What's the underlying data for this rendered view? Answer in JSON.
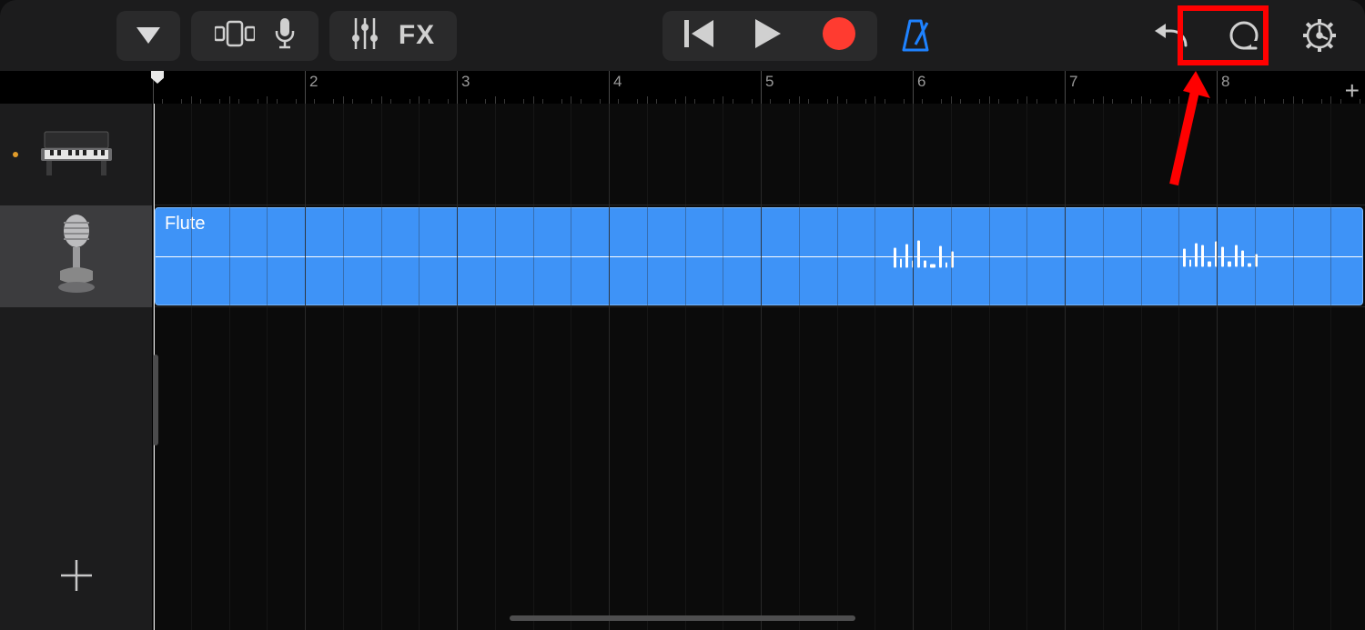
{
  "toolbar": {
    "view_menu": "▼",
    "browser": "browser-icon",
    "mic": "mic-icon",
    "track_controls": "sliders-icon",
    "fx_label": "FX",
    "rewind": "rewind-icon",
    "play": "play-icon",
    "record": "record-icon",
    "metronome": "metronome-icon",
    "undo": "undo-icon",
    "loop": "loop-icon",
    "settings": "gear-icon"
  },
  "ruler": {
    "labels": [
      "2",
      "3",
      "4",
      "5",
      "6",
      "7",
      "8"
    ],
    "add": "+"
  },
  "tracks": [
    {
      "instrument": "Keyboard",
      "selected": false,
      "indicator": true
    },
    {
      "instrument": "Audio Recorder",
      "selected": true,
      "indicator": false
    }
  ],
  "regions": [
    {
      "track_index": 1,
      "name": "Flute",
      "color": "#3e93f7"
    }
  ],
  "annotation": {
    "type": "highlight-arrow",
    "target": "settings-button",
    "color": "#ff0000"
  }
}
